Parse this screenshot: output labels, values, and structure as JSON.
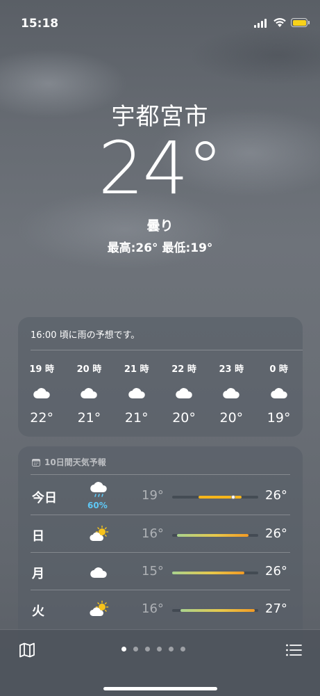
{
  "status_bar": {
    "time": "15:18"
  },
  "location": {
    "city": "宇都宮市",
    "temperature": "24°",
    "condition": "曇り",
    "high_low": "最高:26°  最低:19°"
  },
  "hourly": {
    "message": "16:00 頃に雨の予想です。",
    "items": [
      {
        "time": "19 時",
        "icon": "cloud-icon",
        "temp": "22°"
      },
      {
        "time": "20 時",
        "icon": "cloud-icon",
        "temp": "21°"
      },
      {
        "time": "21 時",
        "icon": "cloud-icon",
        "temp": "21°"
      },
      {
        "time": "22 時",
        "icon": "cloud-icon",
        "temp": "20°"
      },
      {
        "time": "23 時",
        "icon": "cloud-icon",
        "temp": "20°"
      },
      {
        "time": "0 時",
        "icon": "cloud-icon",
        "temp": "19°"
      }
    ]
  },
  "daily": {
    "title": "10日間天気予報",
    "days": [
      {
        "day": "今日",
        "icon": "cloud-rain-icon",
        "pop": "60%",
        "low": "19°",
        "high": "26°",
        "bar_range": [
          0.31,
          0.81
        ],
        "now_marker": 0.71,
        "bar_color": "#f5b51a"
      },
      {
        "day": "日",
        "icon": "cloud-sun-icon",
        "pop": "",
        "low": "16°",
        "high": "26°",
        "bar_range": [
          0.06,
          0.89
        ],
        "bar_color": "gradient-green-orange"
      },
      {
        "day": "月",
        "icon": "cloud-icon",
        "pop": "",
        "low": "15°",
        "high": "26°",
        "bar_range": [
          0.0,
          0.84
        ],
        "bar_color": "gradient-green-orange"
      },
      {
        "day": "火",
        "icon": "cloud-sun-icon",
        "pop": "",
        "low": "16°",
        "high": "27°",
        "bar_range": [
          0.1,
          0.96
        ],
        "bar_color": "gradient-green-orange"
      }
    ]
  },
  "bottom_bar": {
    "page_count": 6,
    "active_page": 0
  }
}
